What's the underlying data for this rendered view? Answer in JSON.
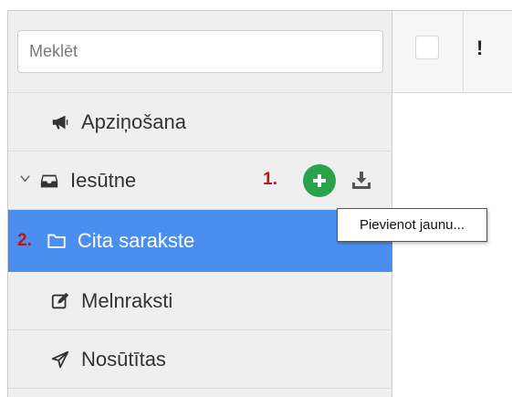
{
  "search": {
    "placeholder": "Meklēt"
  },
  "sidebar": {
    "items": [
      {
        "label": "Apziņošana",
        "icon": "bullhorn-icon"
      },
      {
        "label": "Iesūtne",
        "icon": "inbox-icon",
        "expanded": true,
        "annotation": "1."
      },
      {
        "label": "Cita sarakste",
        "icon": "folder-icon",
        "selected": true,
        "annotation": "2."
      },
      {
        "label": "Melnraksti",
        "icon": "edit-icon"
      },
      {
        "label": "Nosūtītas",
        "icon": "send-icon"
      }
    ],
    "actions": {
      "add": "plus-icon",
      "import": "download-icon"
    }
  },
  "header": {
    "importance_symbol": "!"
  },
  "tooltip": {
    "text": "Pievienot jaunu..."
  },
  "colors": {
    "selected_bg": "#4a8ff0",
    "add_button": "#2aa24a",
    "annotation": "#b01820",
    "sidebar_bg": "#efefef"
  }
}
